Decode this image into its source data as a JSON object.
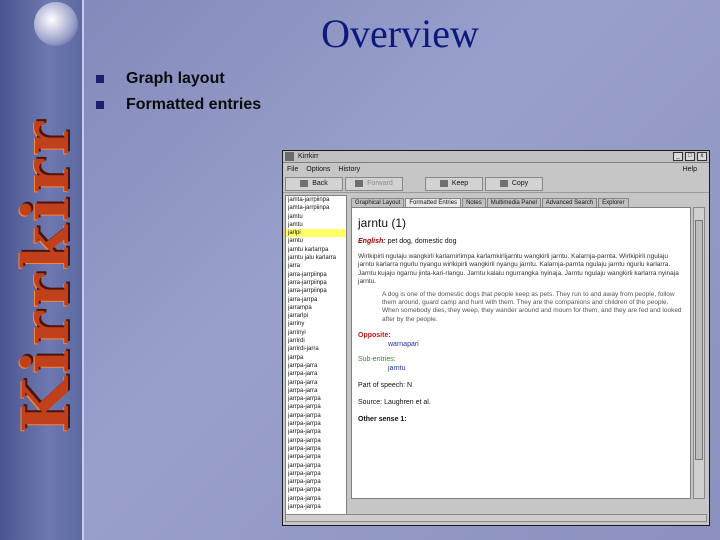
{
  "slide": {
    "title": "Overview",
    "bullets": [
      "Graph layout",
      "Formatted entries"
    ]
  },
  "banner": {
    "word": "Kirrkirr"
  },
  "app": {
    "window_title": "Kirrkirr",
    "menus": [
      "File",
      "Options",
      "History"
    ],
    "help": "Help",
    "toolbar": {
      "back": "Back",
      "forward": "Forward",
      "keep": "Keep",
      "copy": "Copy"
    },
    "word_list": [
      "jamta-jarrpiinpa",
      "jamta-jarrpiinpa",
      "jamtu",
      "jamtu",
      "jarlpi",
      "jarntu",
      "jarntu karlarrpa",
      "jarntu jalu karlarra",
      "jarra",
      "jarra-jarrpiinpa",
      "jarra-jarrpiinpa",
      "jarra-jarrpiinpa",
      "jarra-jarrpa",
      "jarrampa",
      "jarrarlpi",
      "jarriny",
      "jarrinyi",
      "jarrirdi",
      "jarrirdi-jarra",
      "jarrpa",
      "jarrpa-jarra",
      "jarrpa-jarra",
      "jarrpa-jarra",
      "jarrpa-jarra",
      "jarrpa-jarrpa",
      "jarrpa-jarrpa",
      "jarrpa-jarrpa",
      "jarrpa-jarrpa",
      "jarrpa-jarrpa",
      "jarrpa-jarrpa",
      "jarrpa-jarrpa",
      "jarrpa-jarrpa",
      "jarrpa-jarrpa",
      "jarrpa-jarrpa",
      "jarrpa-jarrpa",
      "jarrpa-jarrpa",
      "jarrpa-jarrpa",
      "jarrpa-jarrpa"
    ],
    "selected_index": 4,
    "tabs": [
      "Graphical Layout",
      "Formatted Entries",
      "Notes",
      "Multimedia Panel",
      "Advanced Search",
      "Explorer"
    ],
    "active_tab": 1,
    "entry": {
      "headword": "jarntu (1)",
      "english_label": "English:",
      "english": "pet dog, domestic dog",
      "para1": "Wirlkipirli ngulaju wangkirli karlarnirlimpa karlarnkirlijarntu wangkirli jarntu. Kalarnja-parnta. Wirlkipirli ngulaju jarntu karlarra ngurlu nyangu wirlkipirli wangkirli nyangu jarntu. Kalarnja-parnta ngulaju jarntu ngurlu karlarra. Jarntu kujaju ngarnu jinta-kari-rlangu. Jarntu kalalu ngurrangka nyinaja. Jarntu ngulaju wangkirli karlarra nyinaja jarntu.",
      "para2": "A dog is one of the domestic dogs that people keep as pets. They run to and away from people, follow them around, guard camp and hunt with them. They are the companions and children of the people. When somebody dies, they weep, they wander around and mourn for them, and they are fed and looked after by the people.",
      "opposite_label": "Opposite:",
      "opposite_value": "warnapari",
      "subentries_label": "Sub-entries:",
      "subentries_value": "jarntu",
      "part_of_speech": "Part of speech: N",
      "source": "Source: Laughren et al.",
      "other_sense": "Other sense 1:"
    }
  }
}
